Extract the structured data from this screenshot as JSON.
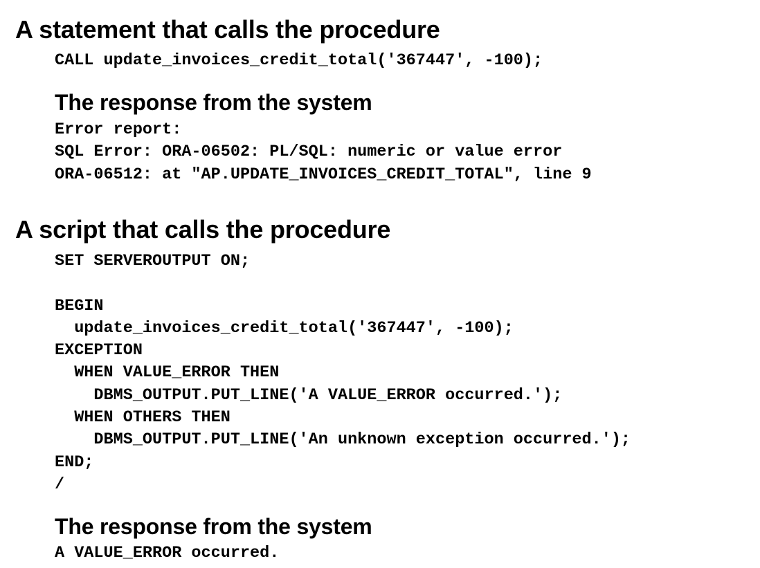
{
  "sections": {
    "statement": {
      "heading": "A statement that calls the procedure",
      "code": "CALL update_invoices_credit_total('367447', -100);",
      "response_heading": "The response from the system",
      "response": "Error report:\nSQL Error: ORA-06502: PL/SQL: numeric or value error\nORA-06512: at \"AP.UPDATE_INVOICES_CREDIT_TOTAL\", line 9"
    },
    "script": {
      "heading": "A script that calls the procedure",
      "code": "SET SERVEROUTPUT ON;\n\nBEGIN\n  update_invoices_credit_total('367447', -100);\nEXCEPTION\n  WHEN VALUE_ERROR THEN\n    DBMS_OUTPUT.PUT_LINE('A VALUE_ERROR occurred.');\n  WHEN OTHERS THEN\n    DBMS_OUTPUT.PUT_LINE('An unknown exception occurred.');\nEND;\n/",
      "response_heading": "The response from the system",
      "response": "A VALUE_ERROR occurred."
    }
  }
}
